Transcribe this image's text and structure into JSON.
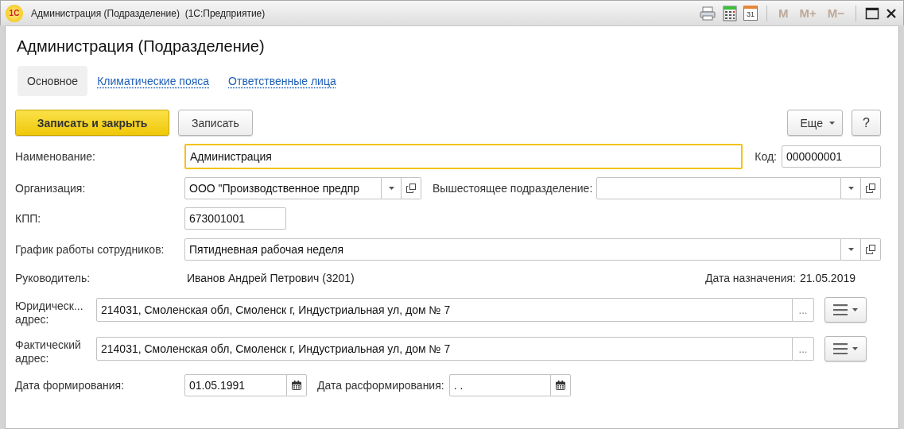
{
  "window": {
    "logo_text": "1С",
    "title": "Администрация (Подразделение)  (1С:Предприятие)",
    "calendar_day": "31",
    "memory_buttons": [
      {
        "label": "M",
        "disabled": true
      },
      {
        "label": "M+",
        "disabled": true
      },
      {
        "label": "M−",
        "disabled": true
      }
    ]
  },
  "heading": "Администрация (Подразделение)",
  "tabs": [
    {
      "label": "Основное",
      "selected": true
    },
    {
      "label": "Климатические пояса",
      "selected": false
    },
    {
      "label": "Ответственные лица",
      "selected": false
    }
  ],
  "command_bar": {
    "buttons": [
      {
        "label": "Записать и закрыть",
        "default": true
      },
      {
        "label": "Записать",
        "default": false
      }
    ],
    "more": "Еще",
    "help": "?"
  },
  "form": {
    "name": {
      "label": "Наименование:",
      "value": "Администрация",
      "focused": true
    },
    "code": {
      "label": "Код:",
      "value": "000000001"
    },
    "organization": {
      "label": "Организация:",
      "value": "ООО \"Производственное предпр"
    },
    "parent": {
      "label": "Вышестоящее подразделение:"
    },
    "kpp": {
      "label": "КПП:",
      "value": "673001001"
    },
    "schedule": {
      "label": "График работы сотрудников:",
      "value": "Пятидневная рабочая неделя"
    },
    "head": {
      "label": "Руководитель:",
      "value": "Иванов Андрей Петрович (3201)",
      "date_label": "Дата назначения:",
      "date": "21.05.2019"
    },
    "addresses": [
      {
        "label": "Юридическ... адрес:",
        "value": "214031, Смоленская обл, Смоленск г, Индустриальная ул, дом № 7",
        "button": "..."
      },
      {
        "label": "Фактический адрес:",
        "value": "214031, Смоленская обл, Смоленск г, Индустриальная ул, дом № 7",
        "button": "..."
      }
    ],
    "formed": {
      "label": "Дата формирования:",
      "value": "01.05.1991"
    },
    "dissolved": {
      "label": "Дата расформирования:",
      "value": ". ."
    }
  }
}
